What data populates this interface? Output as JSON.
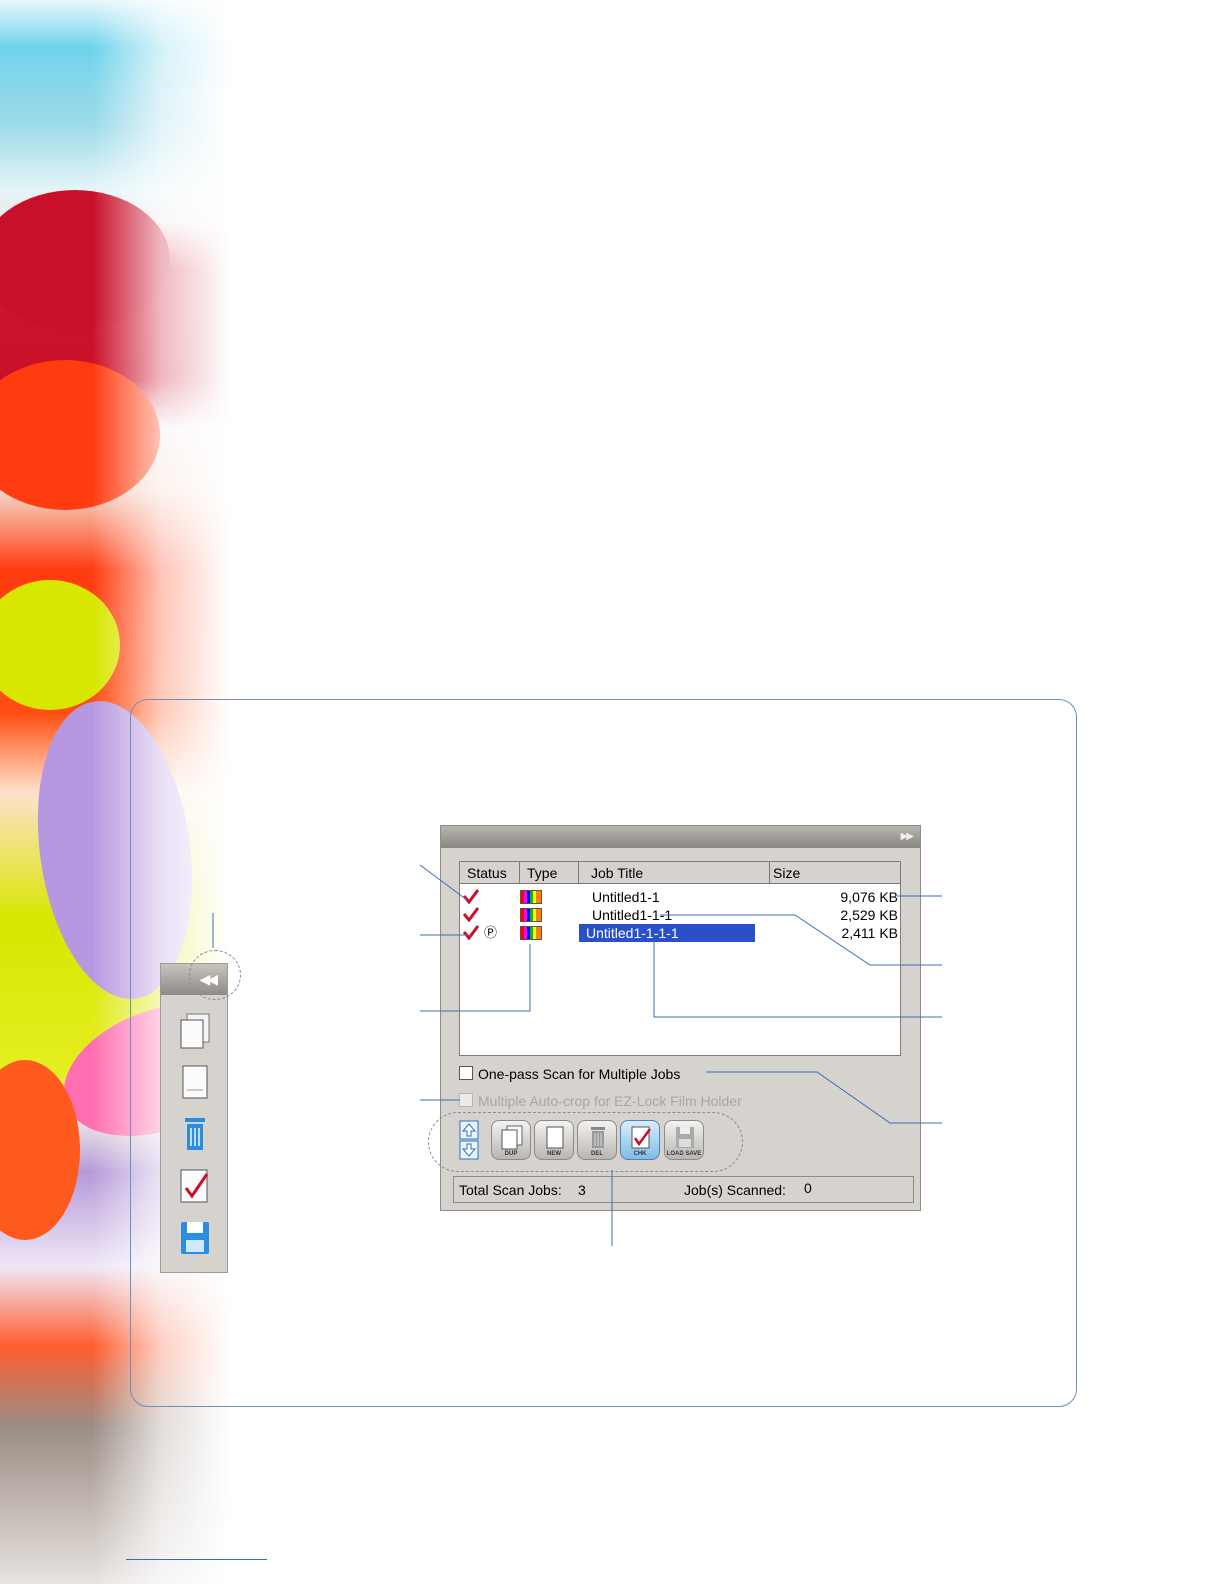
{
  "list": {
    "columns": [
      "Status",
      "Type",
      "Job Title",
      "Size"
    ],
    "rows": [
      {
        "title": "Untitled1-1",
        "size": "9,076 KB",
        "selected": false,
        "pending": false
      },
      {
        "title": "Untitled1-1-1",
        "size": "2,529 KB",
        "selected": false,
        "pending": false
      },
      {
        "title": "Untitled1-1-1-1",
        "size": "2,411 KB",
        "selected": true,
        "pending": true
      }
    ],
    "pending_tag": "Ⓟ"
  },
  "options": {
    "one_pass": "One-pass Scan for Multiple Jobs",
    "auto_crop": "Multiple Auto-crop for EZ-Lock Film Holder"
  },
  "toolbar": {
    "buttons": [
      {
        "caption": "DUP",
        "icon": "duplicate-icon"
      },
      {
        "caption": "NEW",
        "icon": "new-job-icon"
      },
      {
        "caption": "DEL",
        "icon": "delete-icon"
      },
      {
        "caption": "CHK",
        "icon": "check-icon",
        "active": true
      },
      {
        "caption": "LOAD SAVE",
        "icon": "save-icon"
      }
    ]
  },
  "status": {
    "total_label": "Total Scan Jobs:",
    "total_value": "3",
    "scanned_label": "Job(s) Scanned:",
    "scanned_value": "0"
  },
  "colors": {
    "selection": "#2a4fc7",
    "frame": "#6f8fb8",
    "check": "#c8102a"
  }
}
